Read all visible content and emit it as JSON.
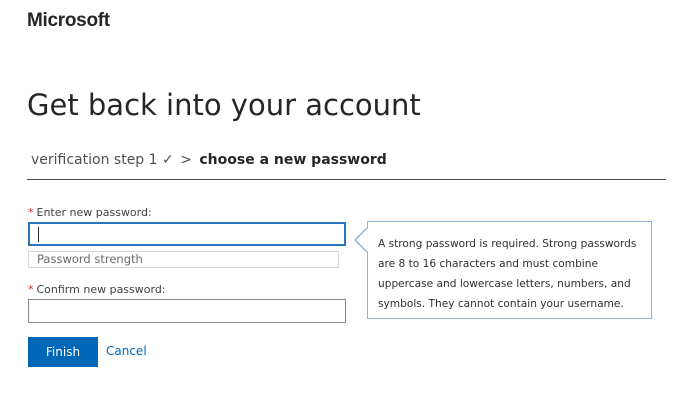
{
  "header": {
    "brand": "Microsoft"
  },
  "main": {
    "title": "Get back into your account",
    "steps": {
      "previous": "verification step 1",
      "previous_check": "✓",
      "separator": ">",
      "current": "choose a new password"
    }
  },
  "form": {
    "required_marker": "*",
    "new_password": {
      "label": "Enter new password:",
      "value": "",
      "focused": true
    },
    "strength": {
      "text": "Password strength"
    },
    "confirm_password": {
      "label": "Confirm new password:",
      "value": ""
    },
    "tooltip": {
      "lines": [
        "A strong password is required. Strong passwords",
        "are 8 to 16 characters and must combine",
        "uppercase and lowercase letters, numbers, and",
        "symbols. They cannot contain your username."
      ]
    }
  },
  "actions": {
    "finish_label": "Finish",
    "cancel_label": "Cancel"
  },
  "colors": {
    "accent": "#0067b8",
    "focus_border": "#2a74c4",
    "required": "#c42b1c",
    "tooltip_border": "#8fb2d3"
  }
}
